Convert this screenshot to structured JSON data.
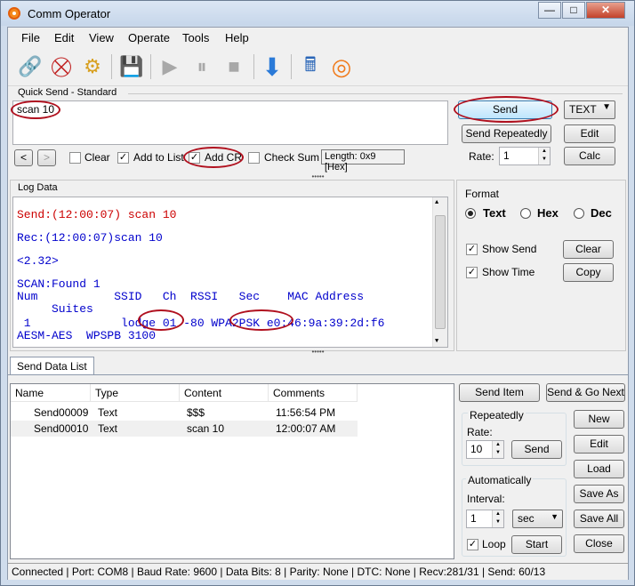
{
  "window": {
    "title": "Comm Operator",
    "minimize_glyph": "—",
    "maximize_glyph": "□",
    "close_glyph": "✕"
  },
  "menu": [
    "File",
    "Edit",
    "View",
    "Operate",
    "Tools",
    "Help"
  ],
  "toolbar_icons": [
    "connect-icon",
    "disconnect-icon",
    "settings-icon",
    "save-icon",
    "play-icon",
    "pause-icon",
    "stop-icon",
    "download-icon",
    "calculator-icon",
    "logo-icon"
  ],
  "quick_send": {
    "group_label": "Quick Send - Standard",
    "input_value": "scan 10",
    "send_label": "Send",
    "send_repeatedly_label": "Send Repeatedly",
    "format_value": "TEXT",
    "edit_label": "Edit",
    "calc_label": "Calc",
    "rate_label": "Rate:",
    "rate_value": "1",
    "prev_label": "<",
    "next_label": ">",
    "clear_label": "Clear",
    "add_to_list_label": "Add to List",
    "add_cr_label": "Add CR",
    "check_sum_label": "Check Sum",
    "length_label": "Length: 0x9 [Hex]",
    "clear_checked": false,
    "add_to_list_checked": true,
    "add_cr_checked": true,
    "check_sum_checked": false
  },
  "log": {
    "group_label": "Log Data",
    "lines": [
      {
        "text": "Send:(12:00:07) scan 10",
        "color": "#cc0000"
      },
      {
        "text": "Rec:(12:00:07)scan 10",
        "color": "#0000cc"
      },
      {
        "text": "<2.32>",
        "color": "#0000cc"
      },
      {
        "text": "SCAN:Found 1",
        "color": "#0000cc"
      },
      {
        "text": "Num           SSID   Ch  RSSI   Sec    MAC Address",
        "color": "#0000cc"
      },
      {
        "text": "     Suites",
        "color": "#0000cc"
      },
      {
        "text": " 1             lodge 01 -80 WPA2PSK e0:46:9a:39:2d:f6",
        "color": "#0000cc"
      },
      {
        "text": "AESM-AES  WPSPB 3100",
        "color": "#0000cc"
      }
    ]
  },
  "format": {
    "group_label": "Format",
    "text_label": "Text",
    "hex_label": "Hex",
    "dec_label": "Dec",
    "selected": "Text",
    "show_send_label": "Show Send",
    "show_time_label": "Show Time",
    "clear_label": "Clear",
    "copy_label": "Copy"
  },
  "send_data_list": {
    "tab_label": "Send Data List",
    "columns": [
      "Name",
      "Type",
      "Content",
      "Comments"
    ],
    "rows": [
      [
        "Send00009",
        "Text",
        "$$$",
        "11:56:54 PM"
      ],
      [
        "Send00010",
        "Text",
        "scan 10",
        "12:00:07 AM"
      ]
    ],
    "send_item_label": "Send Item",
    "send_go_next_label": "Send & Go Next",
    "repeatedly_label": "Repeatedly",
    "rate_label": "Rate:",
    "rate_value": "10",
    "send_label": "Send",
    "automatically_label": "Automatically",
    "interval_label": "Interval:",
    "interval_value": "1",
    "interval_unit": "sec",
    "loop_label": "Loop",
    "start_label": "Start",
    "new_label": "New",
    "edit_label": "Edit",
    "load_label": "Load",
    "save_as_label": "Save As",
    "save_all_label": "Save All",
    "close_label": "Close"
  },
  "status": "Connected | Port: COM8 | Baud Rate: 9600 | Data Bits: 8 | Parity: None | DTC: None | Recv:281/31 | Send: 60/13"
}
